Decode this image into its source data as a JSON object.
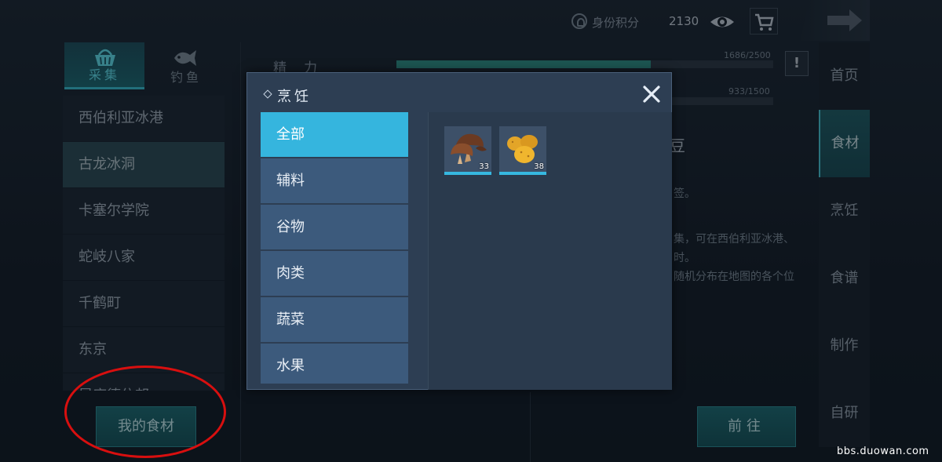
{
  "topbar": {
    "id_score_label": "身份积分",
    "id_score_value": "2130",
    "icons": [
      "id-badge-icon",
      "eye-icon",
      "cart-icon",
      "arrow-icon"
    ]
  },
  "left_panel": {
    "tabs": [
      {
        "label": "采集",
        "icon": "basket-icon",
        "active": true
      },
      {
        "label": "钓鱼",
        "icon": "fish-icon",
        "active": false
      }
    ],
    "locations": [
      {
        "label": "西伯利亚冰港",
        "active": false
      },
      {
        "label": "古龙冰洞",
        "active": true
      },
      {
        "label": "卡塞尔学院",
        "active": false
      },
      {
        "label": "蛇岐八家",
        "active": false
      },
      {
        "label": "千鹤町",
        "active": false
      },
      {
        "label": "东京",
        "active": false
      },
      {
        "label": "昆库德住邦",
        "active": false
      }
    ],
    "my_ingredients_button": "我的食材"
  },
  "background": {
    "stat_label": "精力",
    "bar1": {
      "text": "1686/2500",
      "value": 1686,
      "max": 2500
    },
    "bar2": {
      "text": "933/1500",
      "value": 933,
      "max": 1500
    },
    "desc_title_fragment": "豆",
    "desc_line1": "签。",
    "desc_line2": "集，可在西伯利亚冰港、",
    "desc_line3": "时。",
    "desc_line4": "随机分布在地图的各个位",
    "warn_label": "!",
    "go_button": "前往"
  },
  "right_nav": {
    "items": [
      {
        "label": "首页",
        "active": false
      },
      {
        "label": "食材",
        "active": true
      },
      {
        "label": "烹饪",
        "active": false
      },
      {
        "label": "食谱",
        "active": false
      },
      {
        "label": "制作",
        "active": false
      },
      {
        "label": "自研",
        "active": false
      }
    ]
  },
  "modal": {
    "title": "烹饪",
    "close_icon": "close-icon",
    "categories": [
      {
        "label": "全部",
        "active": true
      },
      {
        "label": "辅料",
        "active": false
      },
      {
        "label": "谷物",
        "active": false
      },
      {
        "label": "肉类",
        "active": false
      },
      {
        "label": "蔬菜",
        "active": false
      },
      {
        "label": "水果",
        "active": false
      }
    ],
    "items": [
      {
        "icon": "mushroom-icon",
        "quantity": "33"
      },
      {
        "icon": "potato-icon",
        "quantity": "38"
      }
    ]
  },
  "watermark": "bbs.duowan.com",
  "colors": {
    "accent": "#35b5de",
    "teal": "#1b6a70",
    "annotation_red": "#d80f0f"
  }
}
